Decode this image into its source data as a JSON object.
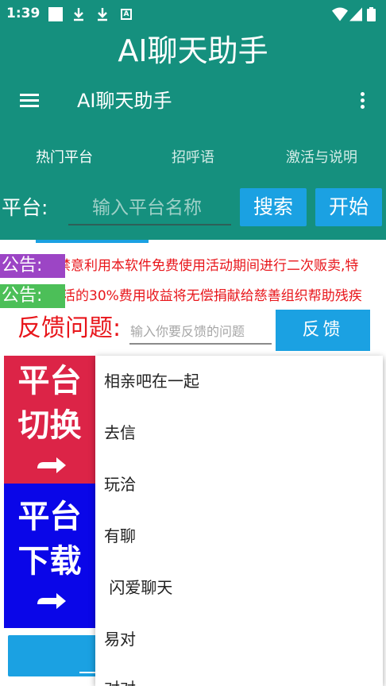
{
  "status_bar": {
    "time": "1:39",
    "left_icons": [
      "white-square-icon",
      "download-icon",
      "download-icon",
      "a-box-icon"
    ],
    "right_icons": [
      "wifi-icon",
      "signal-icon",
      "battery-icon"
    ]
  },
  "header": {
    "big_title": "AI聊天助手",
    "toolbar_title": "AI聊天助手",
    "menu_icon": "hamburger-icon",
    "more_icon": "more-vertical-icon"
  },
  "tabs": [
    {
      "label": "热门平台",
      "selected": true
    },
    {
      "label": "招呼语",
      "selected": false
    },
    {
      "label": "激活与说明",
      "selected": false
    }
  ],
  "search": {
    "label": "平台:",
    "placeholder": "输入平台名称",
    "search_label": "搜索",
    "start_label": "开始"
  },
  "notices": [
    {
      "tag": "公告:",
      "text": "禁意利用本软件免费使用活动期间进行二次贩卖,特"
    },
    {
      "tag": "公告:",
      "text": "活的30%费用收益将无偿捐献给慈善组织帮助残疾"
    }
  ],
  "feedback": {
    "label": "反馈问题:",
    "placeholder": "输入你要反馈的问题",
    "button_label": "反馈"
  },
  "side_buttons": {
    "switch": {
      "line1": "平台",
      "line2": "切换",
      "icon": "arrow-right-icon"
    },
    "download": {
      "line1": "平台",
      "line2": "下载",
      "icon": "arrow-right-icon"
    }
  },
  "dropdown": {
    "items": [
      "相亲吧在一起",
      "去信",
      "玩洽",
      "有聊",
      " 闪爱聊天",
      "易对",
      "对对"
    ]
  },
  "colors": {
    "primary": "#15907e",
    "accent_blue": "#1ba1e2",
    "switch_red": "#dc2447",
    "download_blue": "#0a06e8",
    "notice_red": "#e8161b",
    "tag_purple": "#9c45c5",
    "tag_green": "#4cbf58"
  }
}
